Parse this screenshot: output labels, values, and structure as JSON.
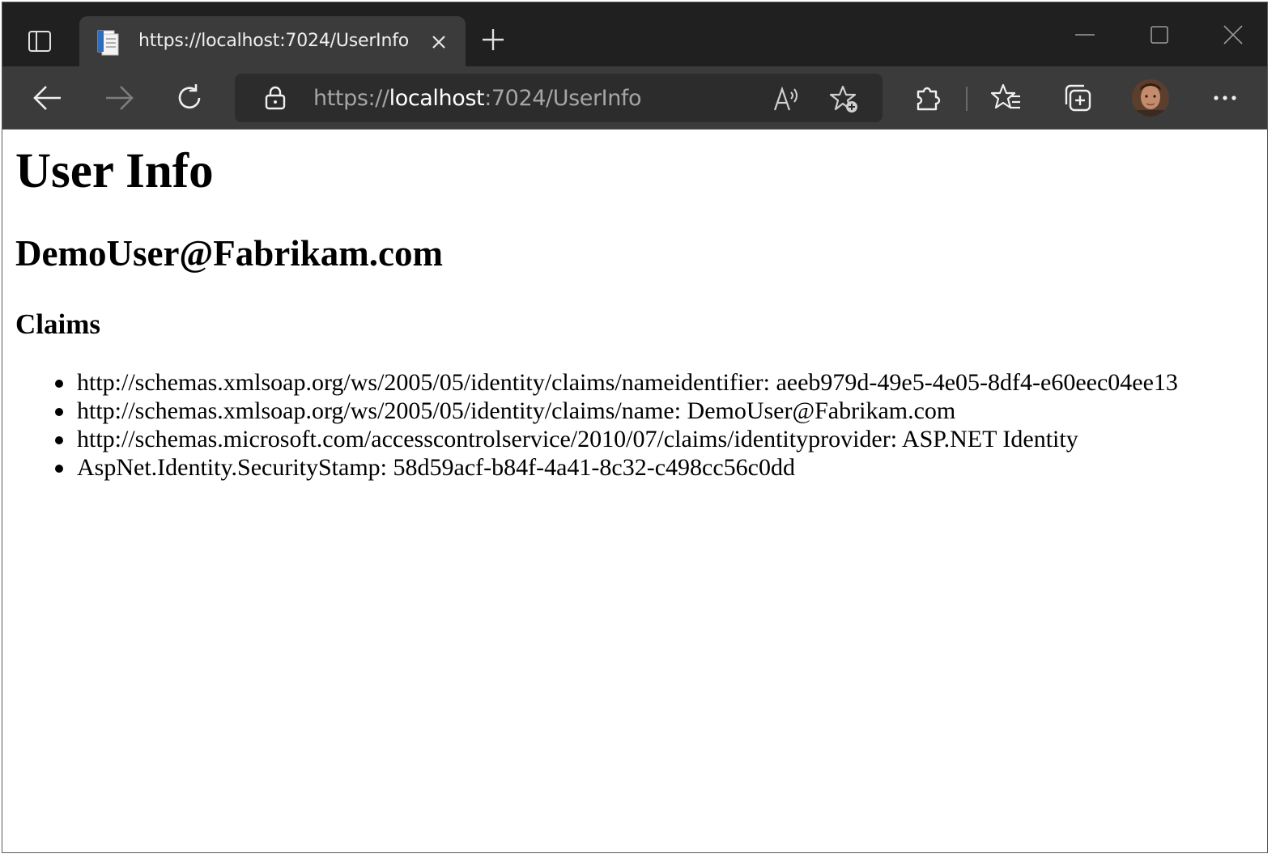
{
  "browser": {
    "tab": {
      "title": "https://localhost:7024/UserInfo"
    },
    "address_bar": {
      "scheme": "https://",
      "host": "localhost",
      "rest": ":7024/UserInfo"
    },
    "icons": {
      "tab_actions": "tab-actions-icon",
      "favicon": "page-icon",
      "close_tab": "close-icon",
      "new_tab": "plus-icon",
      "minimize": "minimize-icon",
      "maximize": "maximize-icon",
      "close_window": "close-icon",
      "back": "arrow-left-icon",
      "forward": "arrow-right-icon",
      "refresh": "refresh-icon",
      "lock": "lock-icon",
      "read_aloud": "read-aloud-icon",
      "add_favorite": "star-plus-icon",
      "extensions": "puzzle-icon",
      "favorites": "favorites-icon",
      "collections": "collections-icon",
      "profile": "avatar",
      "more": "more-icon"
    },
    "colors": {
      "tabstrip": "#202020",
      "toolbar": "#3b3b3b",
      "address_bg": "#2c2c2c"
    }
  },
  "page": {
    "heading": "User Info",
    "user_name": "DemoUser@Fabrikam.com",
    "claims_heading": "Claims",
    "claims": [
      "http://schemas.xmlsoap.org/ws/2005/05/identity/claims/nameidentifier: aeeb979d-49e5-4e05-8df4-e60eec04ee13",
      "http://schemas.xmlsoap.org/ws/2005/05/identity/claims/name: DemoUser@Fabrikam.com",
      "http://schemas.microsoft.com/accesscontrolservice/2010/07/claims/identityprovider: ASP.NET Identity",
      "AspNet.Identity.SecurityStamp: 58d59acf-b84f-4a41-8c32-c498cc56c0dd"
    ]
  }
}
